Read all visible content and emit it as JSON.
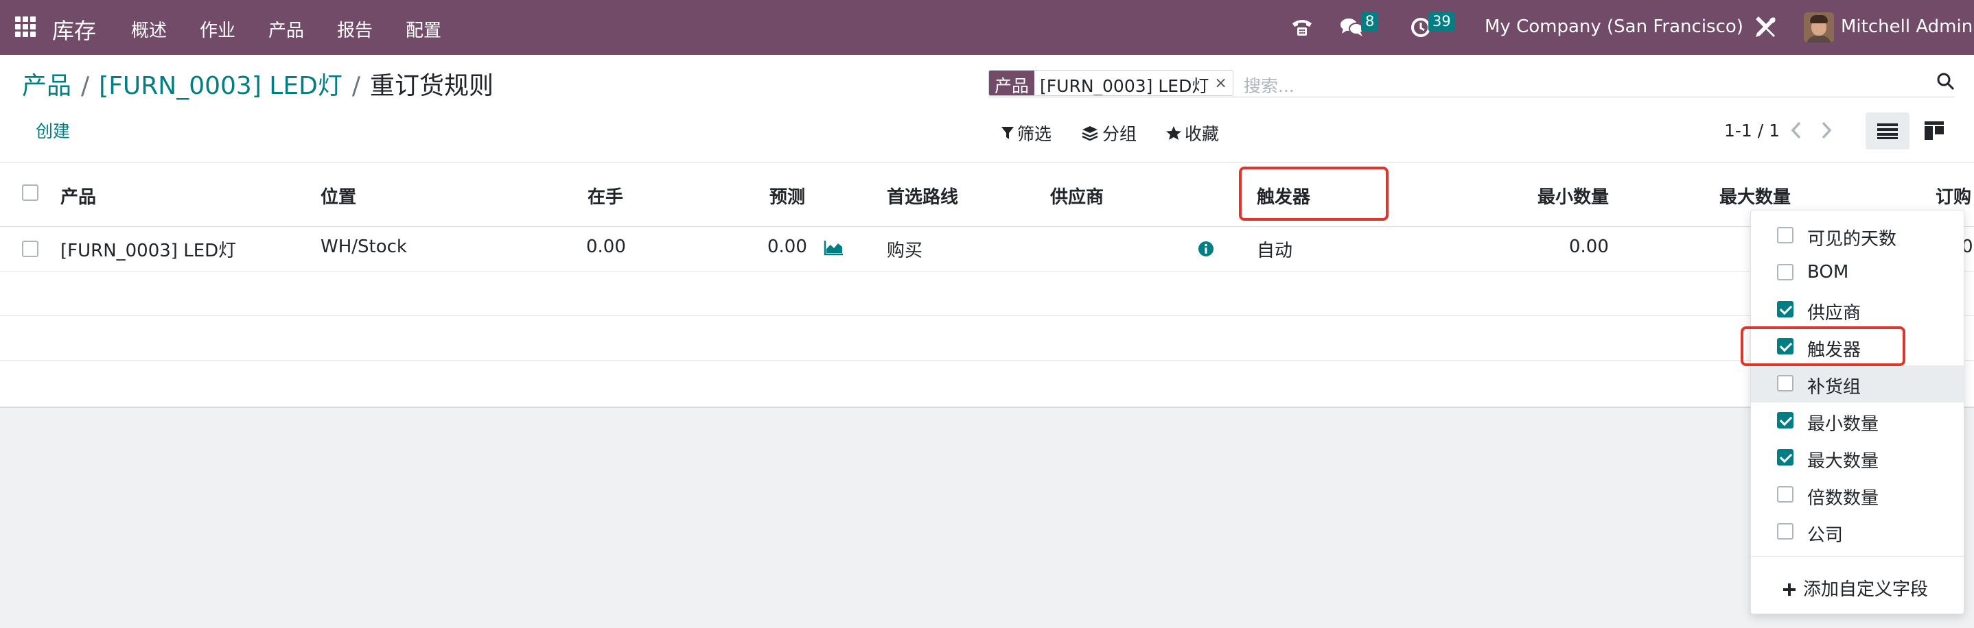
{
  "nav": {
    "brand": "库存",
    "menu": [
      "概述",
      "作业",
      "产品",
      "报告",
      "配置"
    ],
    "messages_count": "8",
    "activities_count": "39",
    "company": "My Company (San Francisco)",
    "user": "Mitchell Admin"
  },
  "breadcrumb": {
    "root": "产品",
    "product": "[FURN_0003] LED灯",
    "current": "重订货规则"
  },
  "toolbar": {
    "create": "创建",
    "filters": "筛选",
    "group_by": "分组",
    "favorites": "收藏",
    "pager": "1-1 / 1"
  },
  "search": {
    "facet_label": "产品",
    "facet_value": "[FURN_0003] LED灯",
    "facet_remove": "×",
    "placeholder": "搜索..."
  },
  "table": {
    "headers": [
      "产品",
      "位置",
      "在手",
      "预测",
      "首选路线",
      "供应商",
      "触发器",
      "最小数量",
      "最大数量",
      "订购"
    ],
    "rows": [
      {
        "product": "[FURN_0003] LED灯",
        "location": "WH/Stock",
        "on_hand": "0.00",
        "forecast": "0.00",
        "route": "购买",
        "trigger": "自动",
        "min_qty": "0.00",
        "order_partial": "0"
      }
    ]
  },
  "optional_columns": [
    {
      "label": "可见的天数",
      "checked": false
    },
    {
      "label": "BOM",
      "checked": false
    },
    {
      "label": "供应商",
      "checked": true
    },
    {
      "label": "触发器",
      "checked": true
    },
    {
      "label": "补货组",
      "checked": false
    },
    {
      "label": "最小数量",
      "checked": true
    },
    {
      "label": "最大数量",
      "checked": true
    },
    {
      "label": "倍数数量",
      "checked": false
    },
    {
      "label": "公司",
      "checked": false
    }
  ],
  "add_custom_field": "添加自定义字段",
  "colors": {
    "navbar": "#714b67",
    "accent": "#017e84",
    "highlight": "#e0352b"
  }
}
